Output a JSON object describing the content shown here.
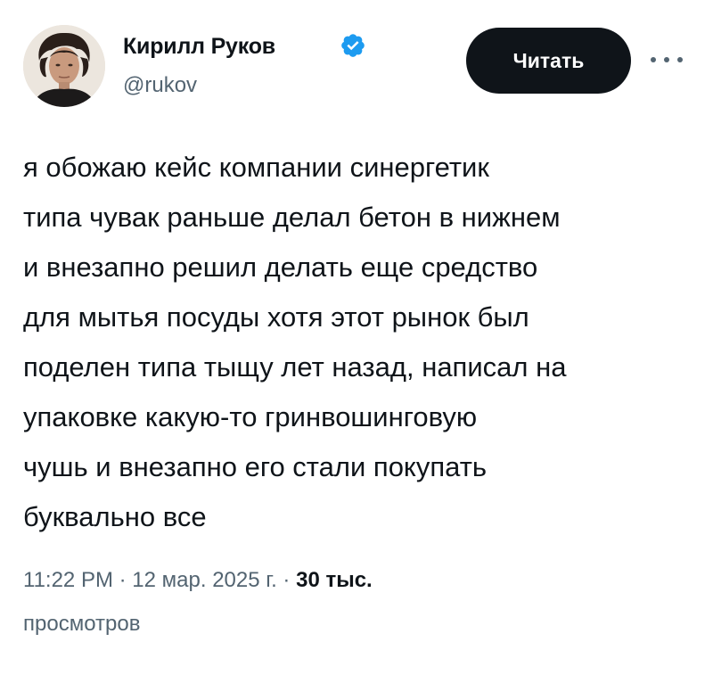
{
  "author": {
    "display_name": "Кирилл Руков",
    "handle": "@rukov",
    "verified_icon": "verified-badge-icon",
    "avatar_icon": "avatar-photo"
  },
  "actions": {
    "follow_label": "Читать",
    "more_icon": "more-options-icon"
  },
  "tweet": {
    "lines": [
      "я обожаю кейс компании синергетик",
      "типа чувак раньше делал бетон в нижнем",
      "и внезапно решил делать еще средство",
      "для мытья посуды хотя этот рынок был",
      "поделен типа тыщу лет назад, написал на",
      "упаковке какую-то гринвошинговую",
      "чушь и внезапно его стали покупать",
      "буквально все"
    ]
  },
  "meta": {
    "time": "11:22 PM",
    "separator": "·",
    "date": "12 мар. 2025 г.",
    "views_count": "30 тыс.",
    "views_label": "просмотров"
  },
  "colors": {
    "text": "#0f1419",
    "secondary": "#536471",
    "verified": "#1d9bf0",
    "button_bg": "#0f1419"
  }
}
